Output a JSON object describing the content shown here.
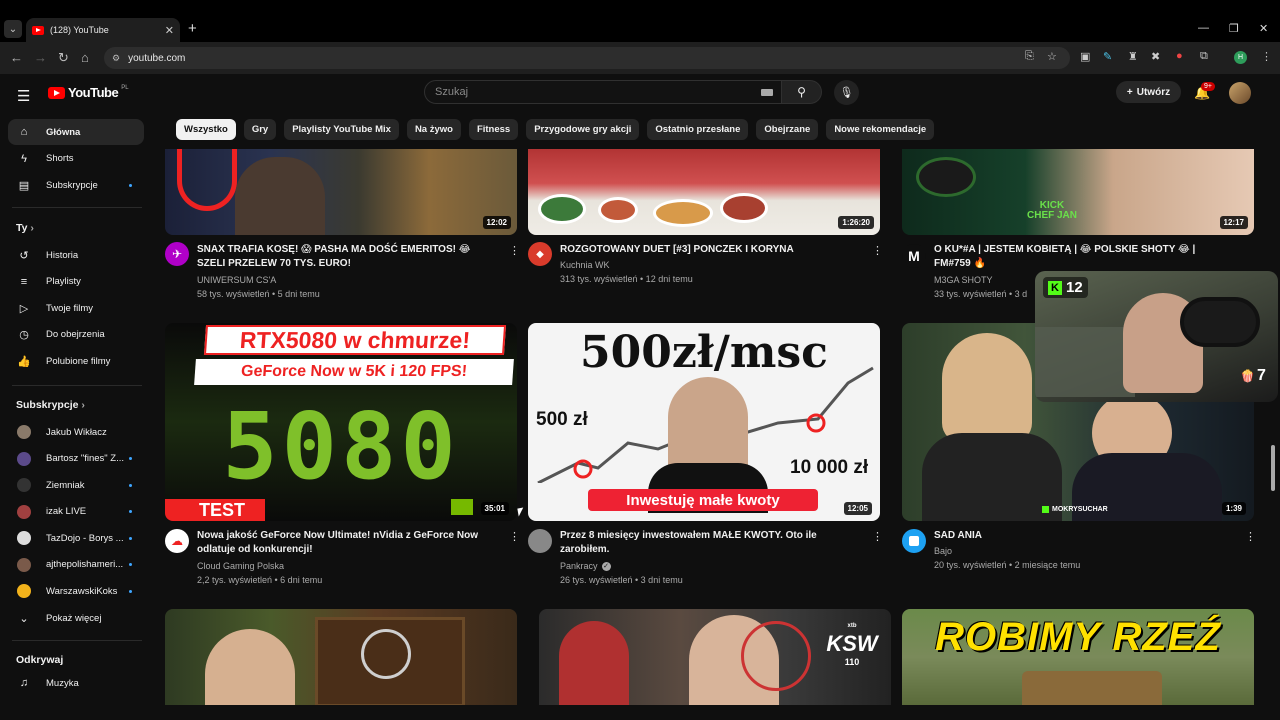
{
  "browser": {
    "tab_title": "(128) YouTube",
    "url": "youtube.com",
    "profile_initial": "H"
  },
  "masthead": {
    "logo_text": "YouTube",
    "country_code": "PL",
    "search_placeholder": "Szukaj",
    "create_label": "Utwórz",
    "notification_count": "9+"
  },
  "chips": [
    "Wszystko",
    "Gry",
    "Playlisty YouTube Mix",
    "Na żywo",
    "Fitness",
    "Przygodowe gry akcji",
    "Ostatnio przesłane",
    "Obejrzane",
    "Nowe rekomendacje"
  ],
  "sidebar": {
    "main": [
      {
        "label": "Główna",
        "icon": "home-icon"
      },
      {
        "label": "Shorts",
        "icon": "shorts-icon"
      },
      {
        "label": "Subskrypcje",
        "icon": "subscriptions-icon"
      }
    ],
    "you_heading": "Ty",
    "you": [
      {
        "label": "Historia",
        "icon": "history-icon"
      },
      {
        "label": "Playlisty",
        "icon": "playlist-icon"
      },
      {
        "label": "Twoje filmy",
        "icon": "your-videos-icon"
      },
      {
        "label": "Do obejrzenia",
        "icon": "watch-later-icon"
      },
      {
        "label": "Polubione filmy",
        "icon": "like-icon"
      }
    ],
    "subs_heading": "Subskrypcje",
    "subs": [
      {
        "label": "Jakub Wikłacz",
        "color": "#8a7a6a",
        "dot": false
      },
      {
        "label": "Bartosz \"fines\" Z...",
        "color": "#5b4a8a",
        "dot": true
      },
      {
        "label": "Ziemniak",
        "color": "#333333",
        "dot": true
      },
      {
        "label": "izak LIVE",
        "color": "#a04040",
        "dot": true
      },
      {
        "label": "TazDojo - Borys ...",
        "color": "#dddddd",
        "dot": true
      },
      {
        "label": "ajthepolishameri...",
        "color": "#7a5a4a",
        "dot": true
      },
      {
        "label": "WarszawskiKoks",
        "color": "#f2b21b",
        "dot": true
      }
    ],
    "show_more": "Pokaż więcej",
    "explore_heading": "Odkrywaj",
    "explore": [
      {
        "label": "Muzyka",
        "icon": "music-icon"
      }
    ]
  },
  "videos_row1": [
    {
      "title": "SNAX TRAFIA KOSĘ! 😱 PASHA MA DOŚĆ EMERITOS! 😂 SZELI PRZELEW 70 TYS. EURO!",
      "channel": "UNIWERSUM CS'A",
      "meta": "58 tys. wyświetleń • 5 dni temu",
      "duration": "12:02",
      "av_color": "#b000c8"
    },
    {
      "title": "ROZGOTOWANY DUET [#3] PONCZEK I KORYNA",
      "channel": "Kuchnia WK",
      "meta": "313 tys. wyświetleń • 12 dni temu",
      "duration": "1:26:20",
      "av_color": "#d93b2b"
    },
    {
      "title": "O KU*#A | JESTEM KOBIETĄ | 😂 POLSKIE SHOTY 😂 | FM#759 🔥",
      "channel": "M3GA SHOTY",
      "meta": "33 tys. wyświetleń • 3 d",
      "duration": "12:17",
      "av_color": "#222222"
    }
  ],
  "videos_row2": [
    {
      "title": "Nowa jakość GeForce Now Ultimate! nVidia z GeForce Now odlatuje od konkurencji!",
      "channel": "Cloud Gaming Polska",
      "meta": "2,2 tys. wyświetleń • 6 dni temu",
      "duration": "35:01",
      "av_color": "#ffffff",
      "thumb_text1": "RTX5080 w chmurze!",
      "thumb_text2": "GeForce Now w 5K i 120 FPS!",
      "thumb_big": "5080",
      "thumb_badge": "TEST"
    },
    {
      "title": "Przez 8 miesięcy inwestowałem MAŁE KWOTY. Oto ile zarobiłem.",
      "channel": "Pankracy",
      "meta": "26 tys. wyświetleń • 3 dni temu",
      "duration": "12:05",
      "av_color": "#777777",
      "thumb_head": "500zł/msc",
      "thumb_left": "500 zł",
      "thumb_right": "10 000 zł",
      "thumb_banner": "Inwestuję małe kwoty"
    },
    {
      "title": "SAD ANIA",
      "channel": "Bajo",
      "meta": "20 tys. wyświetleń • 2 miesiące temu",
      "duration": "1:39",
      "av_color": "#1da1f2",
      "thumb_tag": "MOKRYSUCHAR"
    }
  ],
  "videos_row3": [
    {
      "thumb": "witcher"
    },
    {
      "thumb": "ksw",
      "badge_top": "xtb",
      "badge": "KSW",
      "badge_num": "110"
    },
    {
      "thumb": "tank",
      "thumb_text": "ROBIMY RZEŹ"
    }
  ],
  "overlay": {
    "kick_count": "12",
    "popcorn_count": "7"
  }
}
